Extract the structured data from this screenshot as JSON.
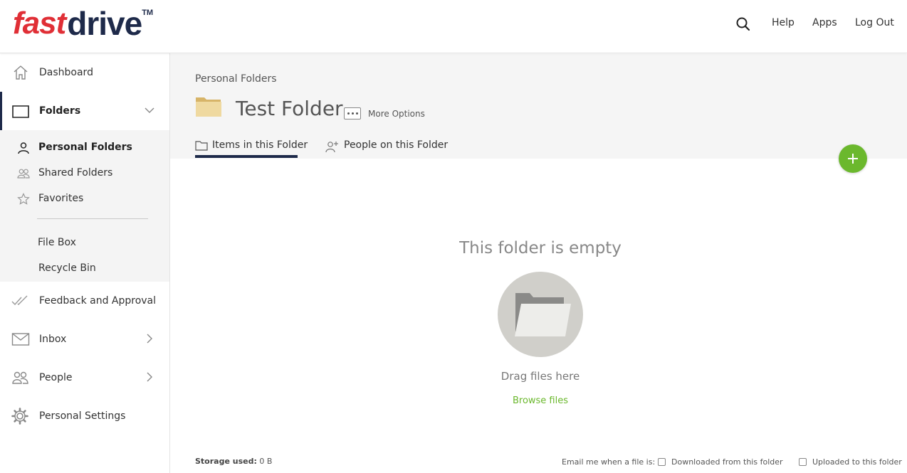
{
  "header": {
    "logo": {
      "part1": "fast",
      "part2": "drive",
      "tm": "TM"
    },
    "search_icon": "search-icon",
    "links": {
      "help": "Help",
      "apps": "Apps",
      "logout": "Log Out"
    }
  },
  "sidebar": {
    "dashboard": "Dashboard",
    "folders": "Folders",
    "sub": {
      "personal": "Personal Folders",
      "shared": "Shared Folders",
      "favorites": "Favorites",
      "filebox": "File Box",
      "recycle": "Recycle Bin"
    },
    "feedback": "Feedback and Approval",
    "inbox": "Inbox",
    "people": "People",
    "settings": "Personal Settings"
  },
  "main": {
    "breadcrumb": "Personal Folders",
    "folder_title": "Test Folder",
    "more_options": "More Options",
    "tabs": {
      "items": "Items in this Folder",
      "people": "People on this Folder"
    },
    "empty": {
      "title": "This folder is empty",
      "drag": "Drag files here",
      "browse": "Browse files"
    },
    "footer": {
      "storage_label": "Storage used:",
      "storage_value": "0 B",
      "email_label": "Email me when a file is:",
      "downloaded": "Downloaded from this folder",
      "uploaded": "Uploaded to this folder"
    }
  },
  "colors": {
    "brand_red": "#e02f36",
    "brand_navy": "#1e2a4a",
    "accent_green": "#6bb82d"
  }
}
